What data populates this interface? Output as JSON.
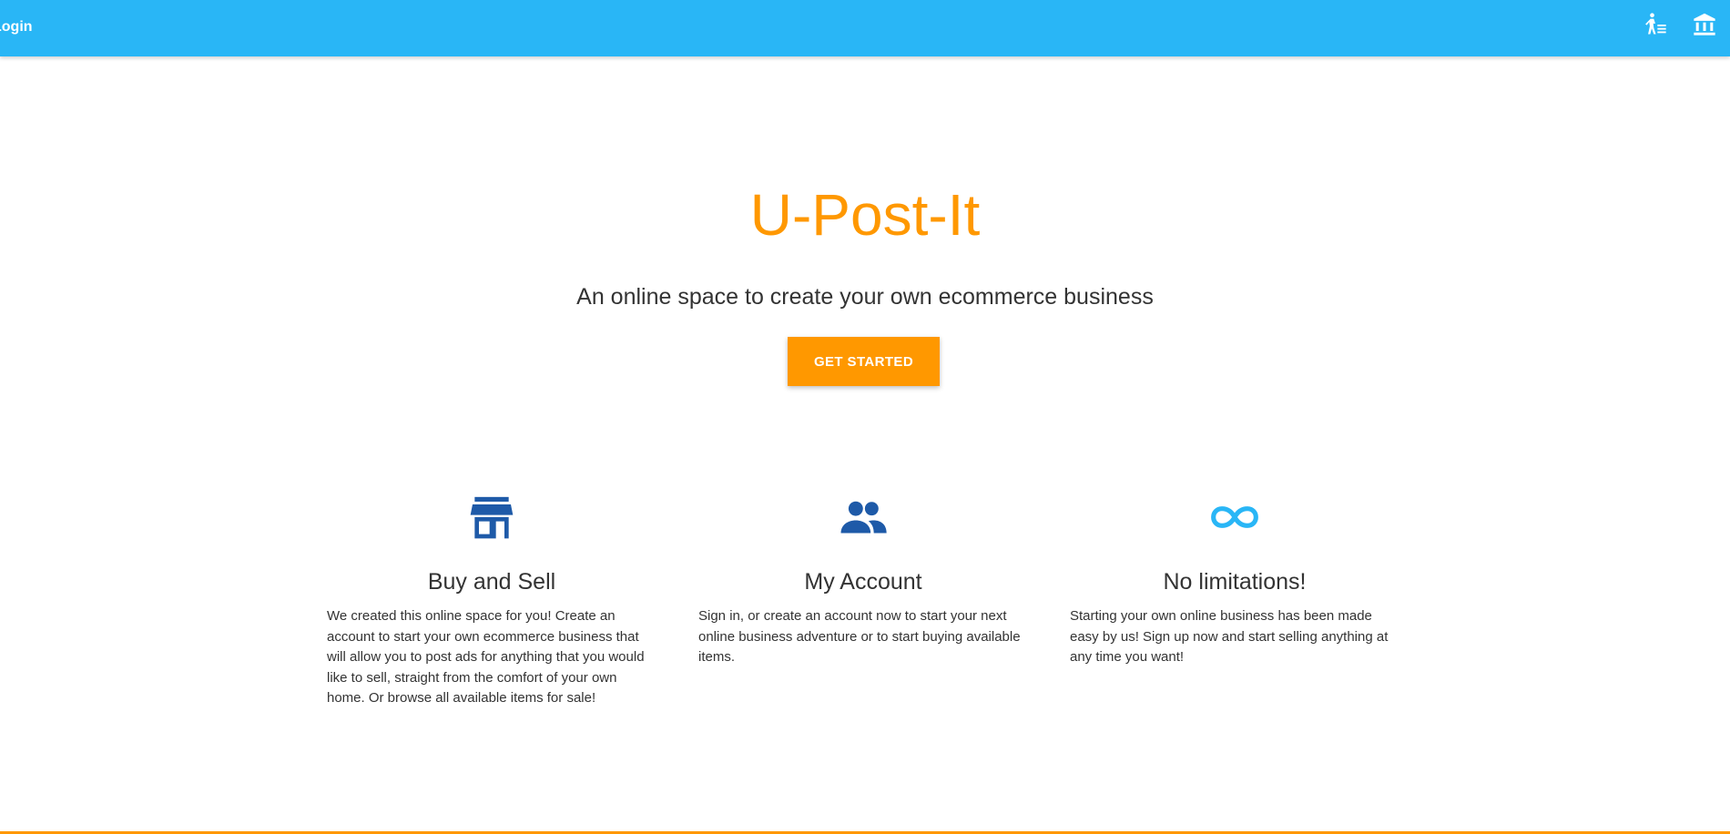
{
  "navbar": {
    "login_label": "Login",
    "icons": [
      "cart-icon",
      "bank-icon"
    ],
    "background": "#29b6f6"
  },
  "hero": {
    "title": "U-Post-It",
    "subtitle": "An online space to create your own ecommerce business",
    "cta_label": "GET STARTED",
    "accent": "#ff9800"
  },
  "features": [
    {
      "icon": "store-icon",
      "title": "Buy and Sell",
      "text": "We created this online space for you! Create an account to start your own ecommerce business that will allow you to post ads for anything that you would like to sell, straight from the comfort of your own home. Or browse all available items for sale!"
    },
    {
      "icon": "people-icon",
      "title": "My Account",
      "text": "Sign in, or create an account now to start your next online business adventure or to start buying available items."
    },
    {
      "icon": "infinity-icon",
      "title": "No limitations!",
      "text": "Starting your own online business has been made easy by us! Sign up now and start selling anything at any time you want!"
    }
  ],
  "colors": {
    "icon_blue": "#1e5aa8",
    "icon_light_blue": "#29b6f6"
  }
}
